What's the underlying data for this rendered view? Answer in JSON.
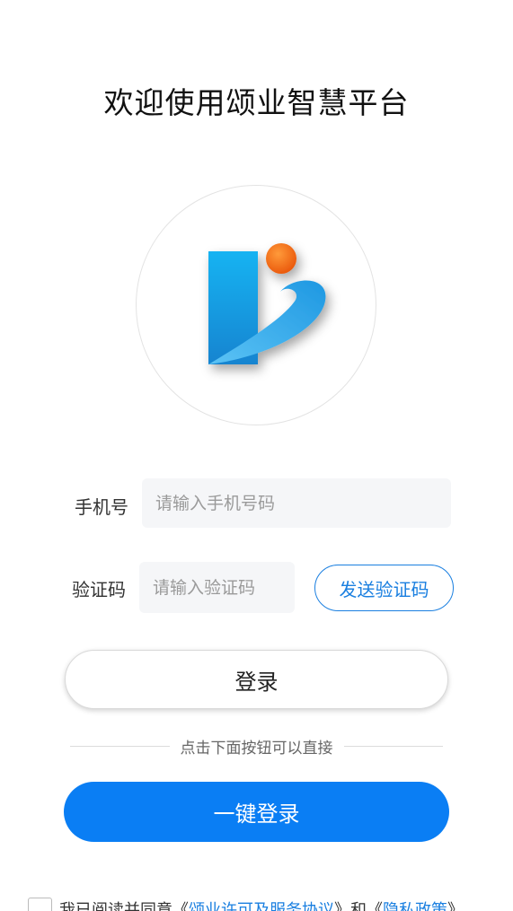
{
  "page": {
    "title": "欢迎使用颂业智慧平台"
  },
  "logo": {
    "icon": "company-logo",
    "colors": {
      "bar": "#1aa2ea",
      "dot": "#f26a10",
      "swoosh": "#2d9be0"
    }
  },
  "form": {
    "phone": {
      "label": "手机号",
      "placeholder": "请输入手机号码",
      "value": ""
    },
    "code": {
      "label": "验证码",
      "placeholder": "请输入验证码",
      "value": ""
    },
    "send_code_label": "发送验证码",
    "login_label": "登录"
  },
  "quick_login": {
    "hint": "点击下面按钮可以直接",
    "button_label": "一键登录"
  },
  "agreement": {
    "checked": false,
    "prefix": "我已阅读并同意",
    "open_quote_1": "《",
    "service_link": "颂业许可及服务协议",
    "close_quote_1": "》",
    "and": "和",
    "open_quote_2": "《",
    "privacy_link": "隐私政策",
    "close_quote_2": "》"
  },
  "colors": {
    "accent": "#0a7ef4",
    "link": "#1a7fe0",
    "input_bg": "#f5f6f8"
  }
}
